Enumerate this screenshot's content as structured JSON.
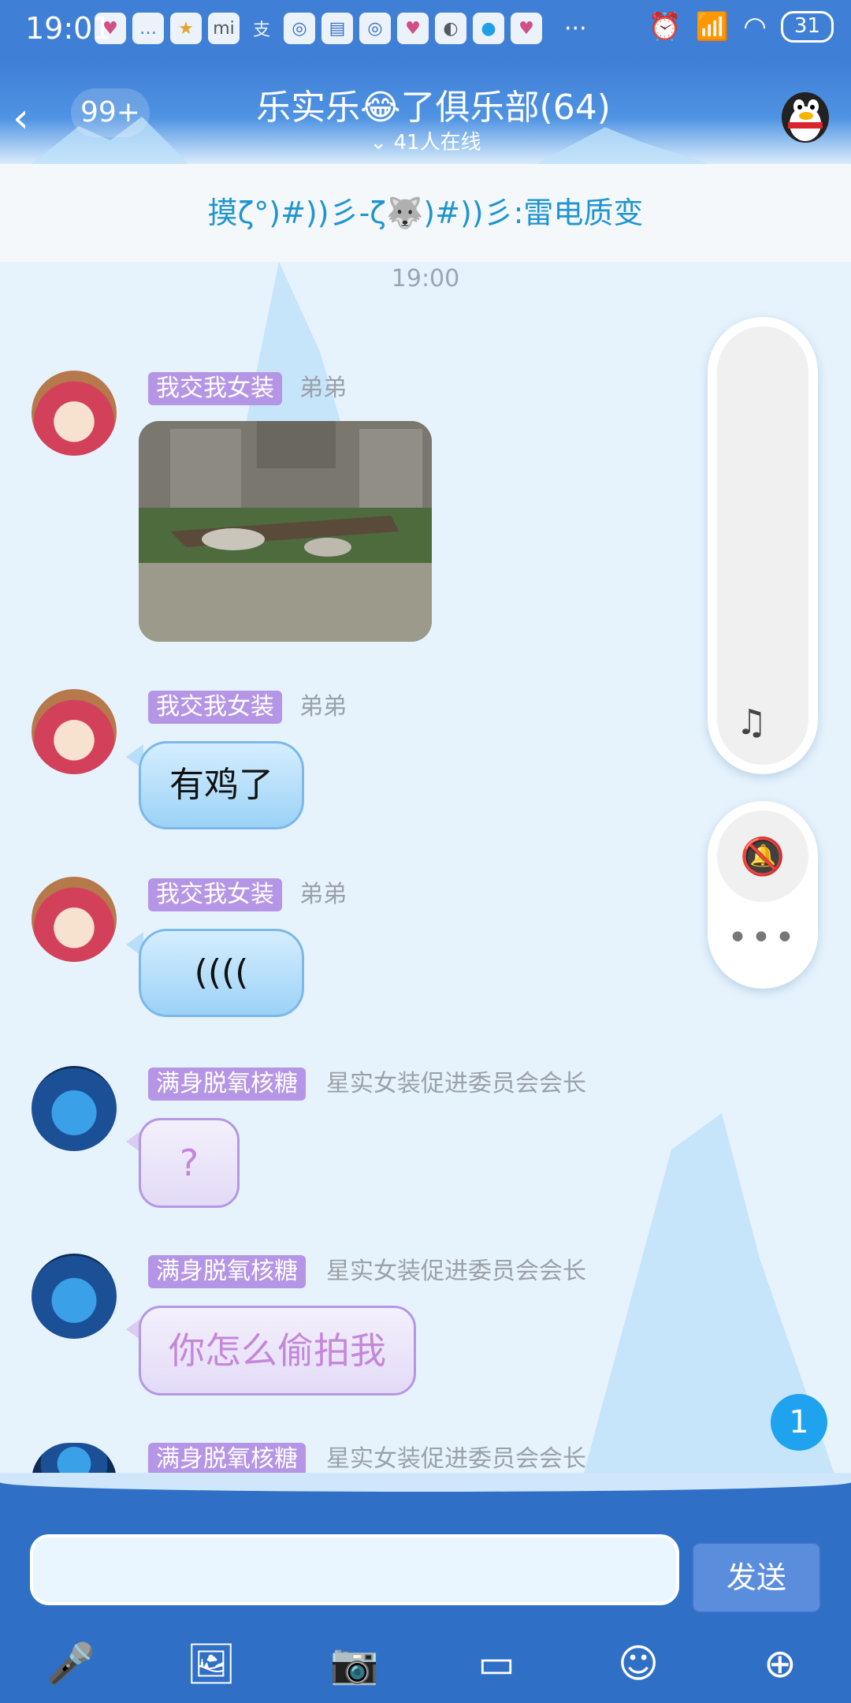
{
  "status_bar": {
    "time": "19:01",
    "app_icons": [
      "LaLa",
      "msg",
      "star",
      "mi",
      "alipay",
      "browser",
      "doc",
      "browser",
      "LaLa",
      "planet",
      "bird",
      "LaLa"
    ],
    "more": "···",
    "battery": "31"
  },
  "header": {
    "back_label": "<",
    "unread": "99+",
    "title": "乐实乐😂了俱乐部(64)",
    "online": "41人在线"
  },
  "notice": {
    "text": "摸ζ°)#))彡-ζ🐺)#))彡:雷电质变"
  },
  "timestamp": "19:00",
  "messages": [
    {
      "name": "我交我女装",
      "title": "弟弟",
      "type": "image"
    },
    {
      "name": "我交我女装",
      "title": "弟弟",
      "text": "有鸡了"
    },
    {
      "name": "我交我女装",
      "title": "弟弟",
      "text": "(((("
    },
    {
      "name": "满身脱氧核糖",
      "title": "星实女装促进委员会会长",
      "text": "?"
    },
    {
      "name": "满身脱氧核糖",
      "title": "星实女装促进委员会会长",
      "text": "你怎么偷拍我"
    },
    {
      "name": "满身脱氧核糖",
      "title": "星实女装促进委员会会长"
    }
  ],
  "side_panel": {
    "more_label": "•••"
  },
  "new_message_count": "1",
  "composer": {
    "send_label": "发送",
    "input_value": ""
  },
  "toolbar": [
    "microphone-icon",
    "photo-icon",
    "camera-icon",
    "card-icon",
    "emoji-icon",
    "plus-icon"
  ],
  "colors": {
    "header": "#3f7fd6",
    "name_tag": "#b595e5",
    "bottom_bar": "#2f6fc5",
    "badge": "#1fa3ee"
  }
}
